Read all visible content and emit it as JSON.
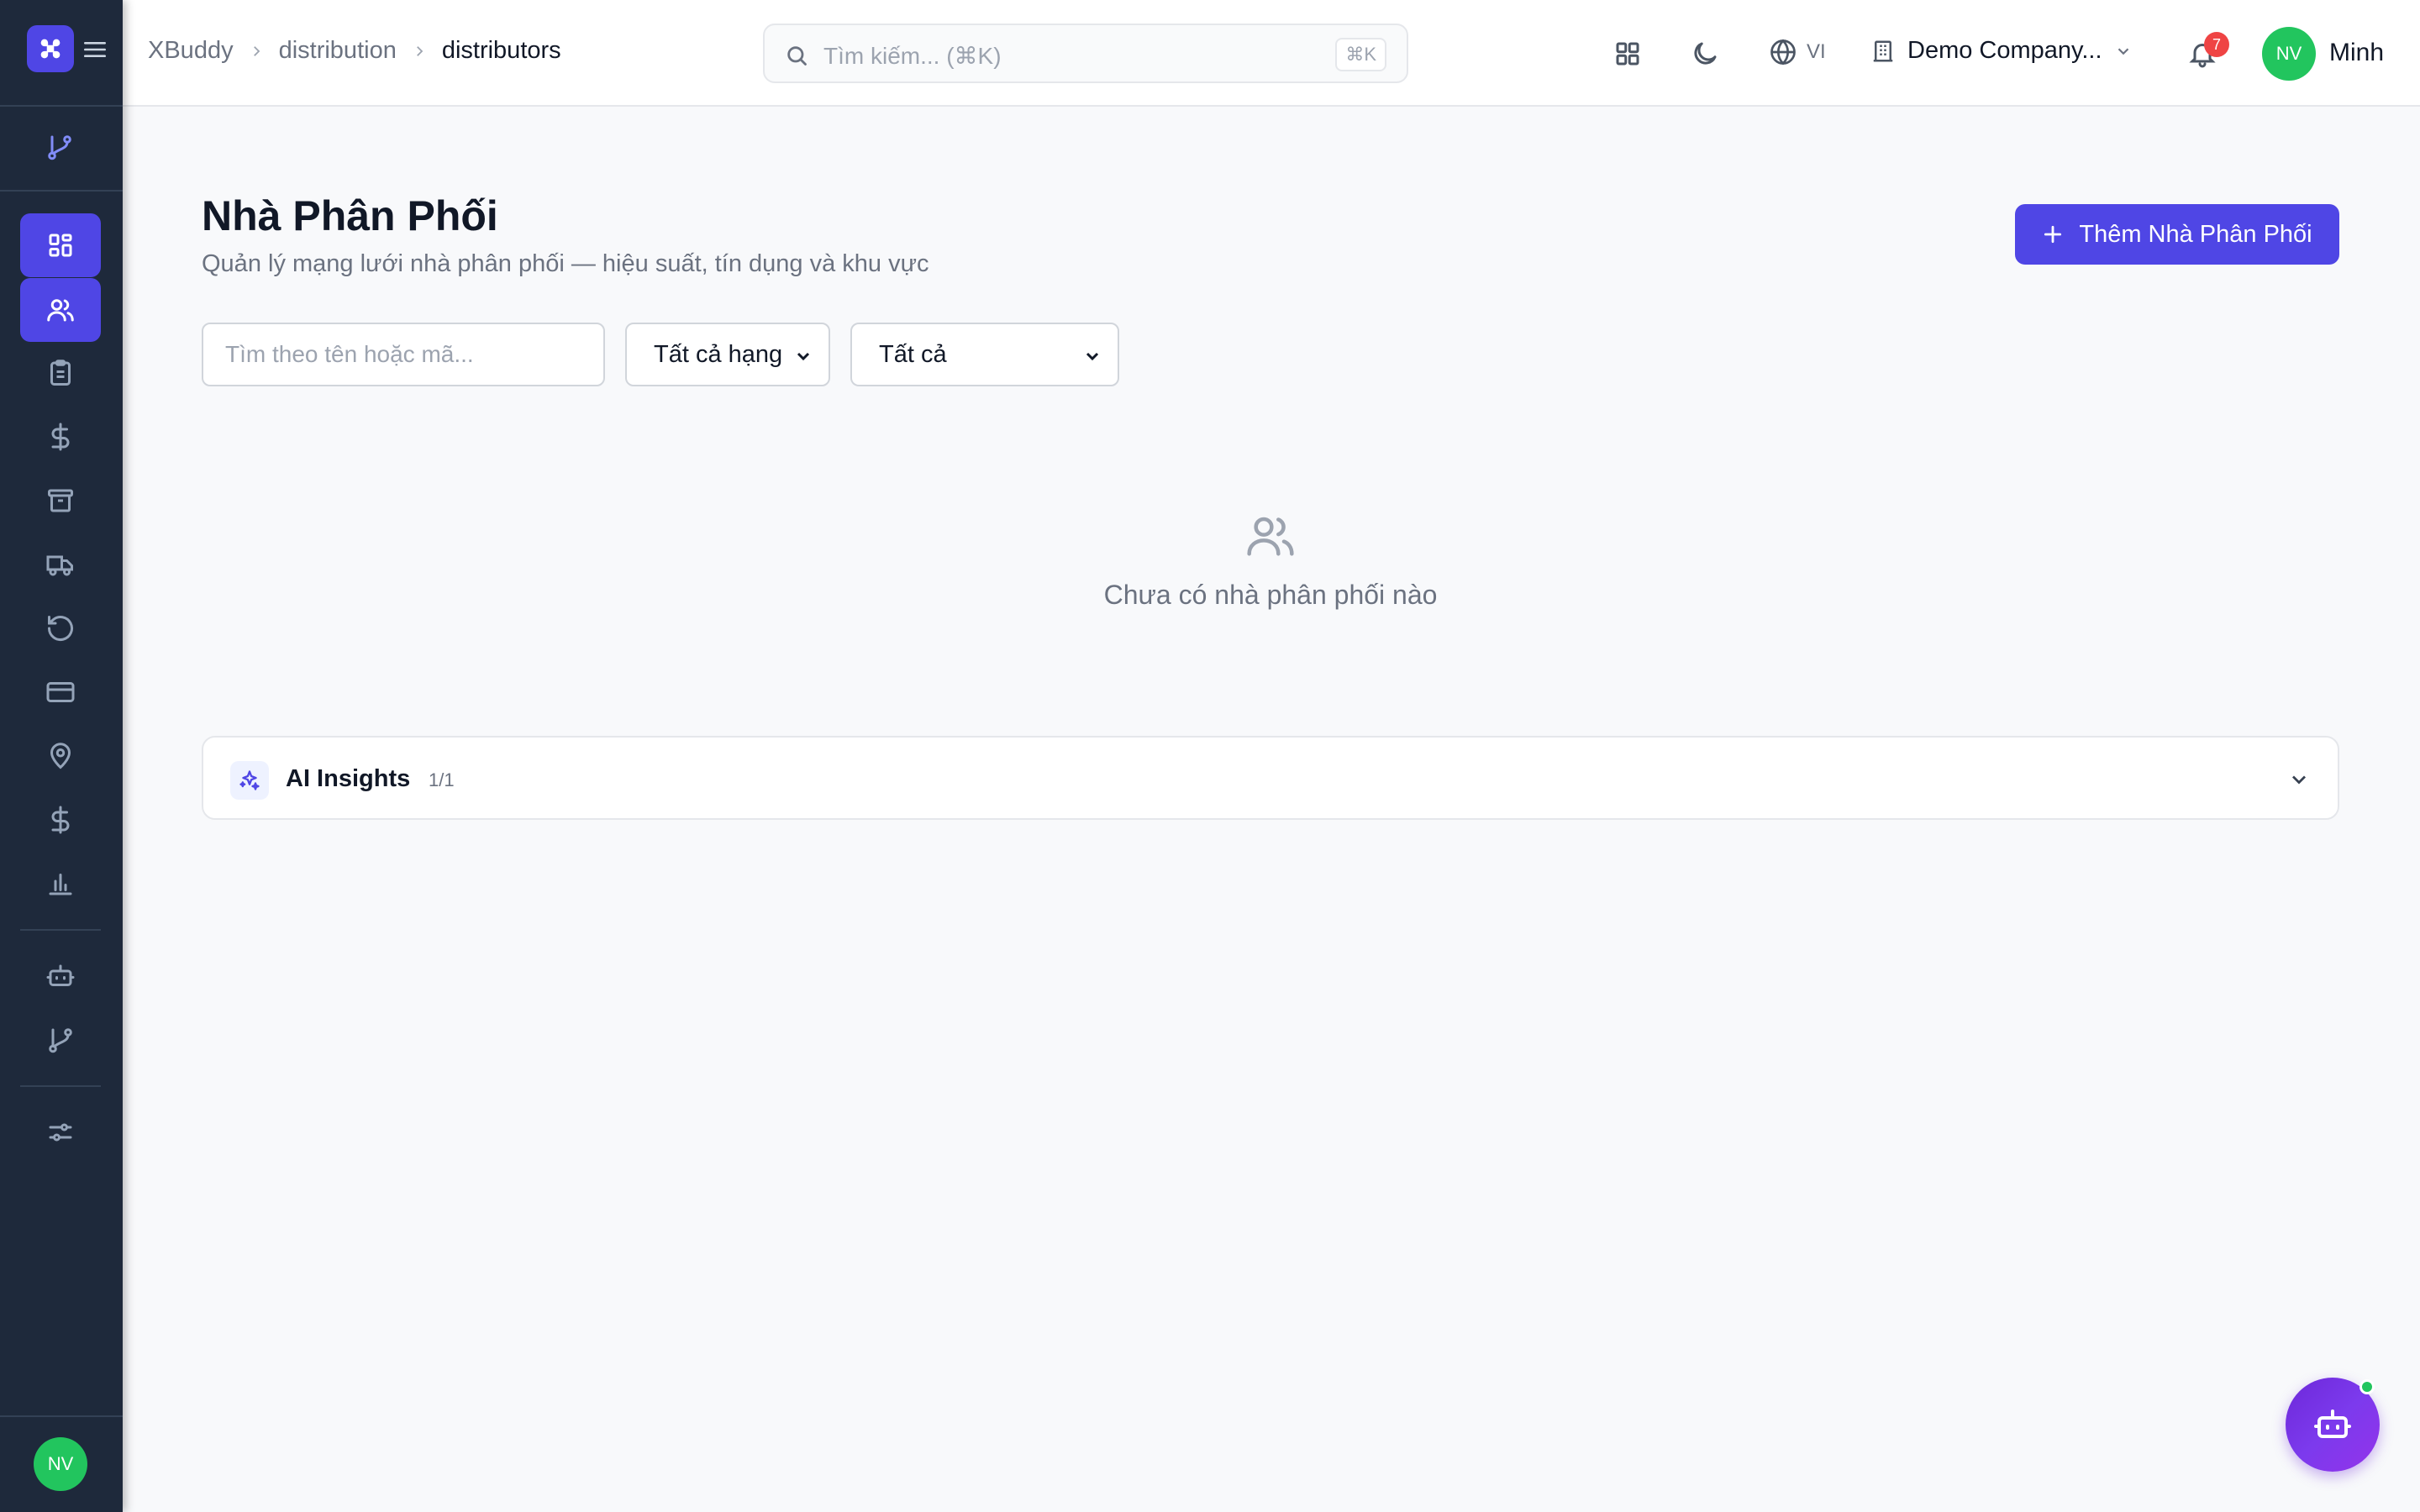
{
  "header": {
    "breadcrumb": [
      "XBuddy",
      "distribution",
      "distributors"
    ],
    "search_placeholder": "Tìm kiếm... (⌘K)",
    "search_shortcut": "⌘K",
    "language": "VI",
    "company": "Demo Company...",
    "notification_count": "7",
    "user_initials": "NV",
    "user_name": "Minh"
  },
  "sidebar": {
    "items": [
      {
        "icon": "grid-icon",
        "active": true
      },
      {
        "icon": "users-icon",
        "active": true
      },
      {
        "icon": "clipboard-icon",
        "active": false
      },
      {
        "icon": "dollar-icon",
        "active": false
      },
      {
        "icon": "archive-icon",
        "active": false
      },
      {
        "icon": "truck-icon",
        "active": false
      },
      {
        "icon": "rotate-icon",
        "active": false
      },
      {
        "icon": "credit-card-icon",
        "active": false
      },
      {
        "icon": "map-pin-icon",
        "active": false
      },
      {
        "icon": "dollar-icon",
        "active": false
      },
      {
        "icon": "bar-chart-icon",
        "active": false
      },
      {
        "icon": "bot-icon",
        "active": false
      },
      {
        "icon": "git-branch-icon",
        "active": false
      },
      {
        "icon": "sliders-icon",
        "active": false
      }
    ],
    "avatar_initials": "NV"
  },
  "page": {
    "title": "Nhà Phân Phối",
    "subtitle": "Quản lý mạng lưới nhà phân phối — hiệu suất, tín dụng và khu vực",
    "add_button_label": "Thêm Nhà Phân Phối",
    "filter_search_placeholder": "Tìm theo tên hoặc mã...",
    "tier_select_value": "Tất cả hạng",
    "status_select_value": "Tất cả",
    "empty_text": "Chưa có nhà phân phối nào"
  },
  "ai_insights": {
    "title": "AI Insights",
    "count": "1/1"
  },
  "colors": {
    "accent": "#4f46e5",
    "sidebar_bg": "#1e293b",
    "avatar": "#22c55e",
    "badge": "#ef4444"
  }
}
